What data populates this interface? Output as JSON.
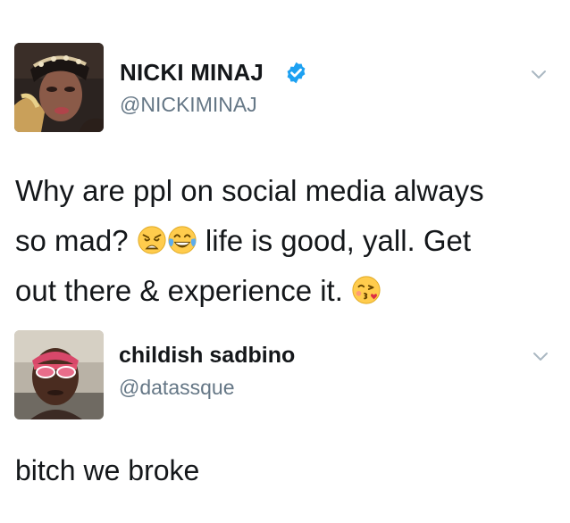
{
  "tweets": [
    {
      "display_name": "NICKI MINAJ",
      "handle": "@NICKIMINAJ",
      "verified": true,
      "text_lines": [
        "Why are ppl on social media always",
        "so mad?",
        "life is good, yall. Get",
        "out there & experience it."
      ],
      "emojis": [
        "weary-face-icon",
        "tears-of-joy-icon",
        "kissing-heart-icon"
      ]
    },
    {
      "display_name": "childish sadbino",
      "handle": "@datassque",
      "verified": false,
      "text_lines": [
        "bitch we broke"
      ]
    }
  ],
  "colors": {
    "text": "#14171a",
    "secondary": "#657786",
    "verified_blue": "#1da1f2",
    "background": "#ffffff"
  }
}
